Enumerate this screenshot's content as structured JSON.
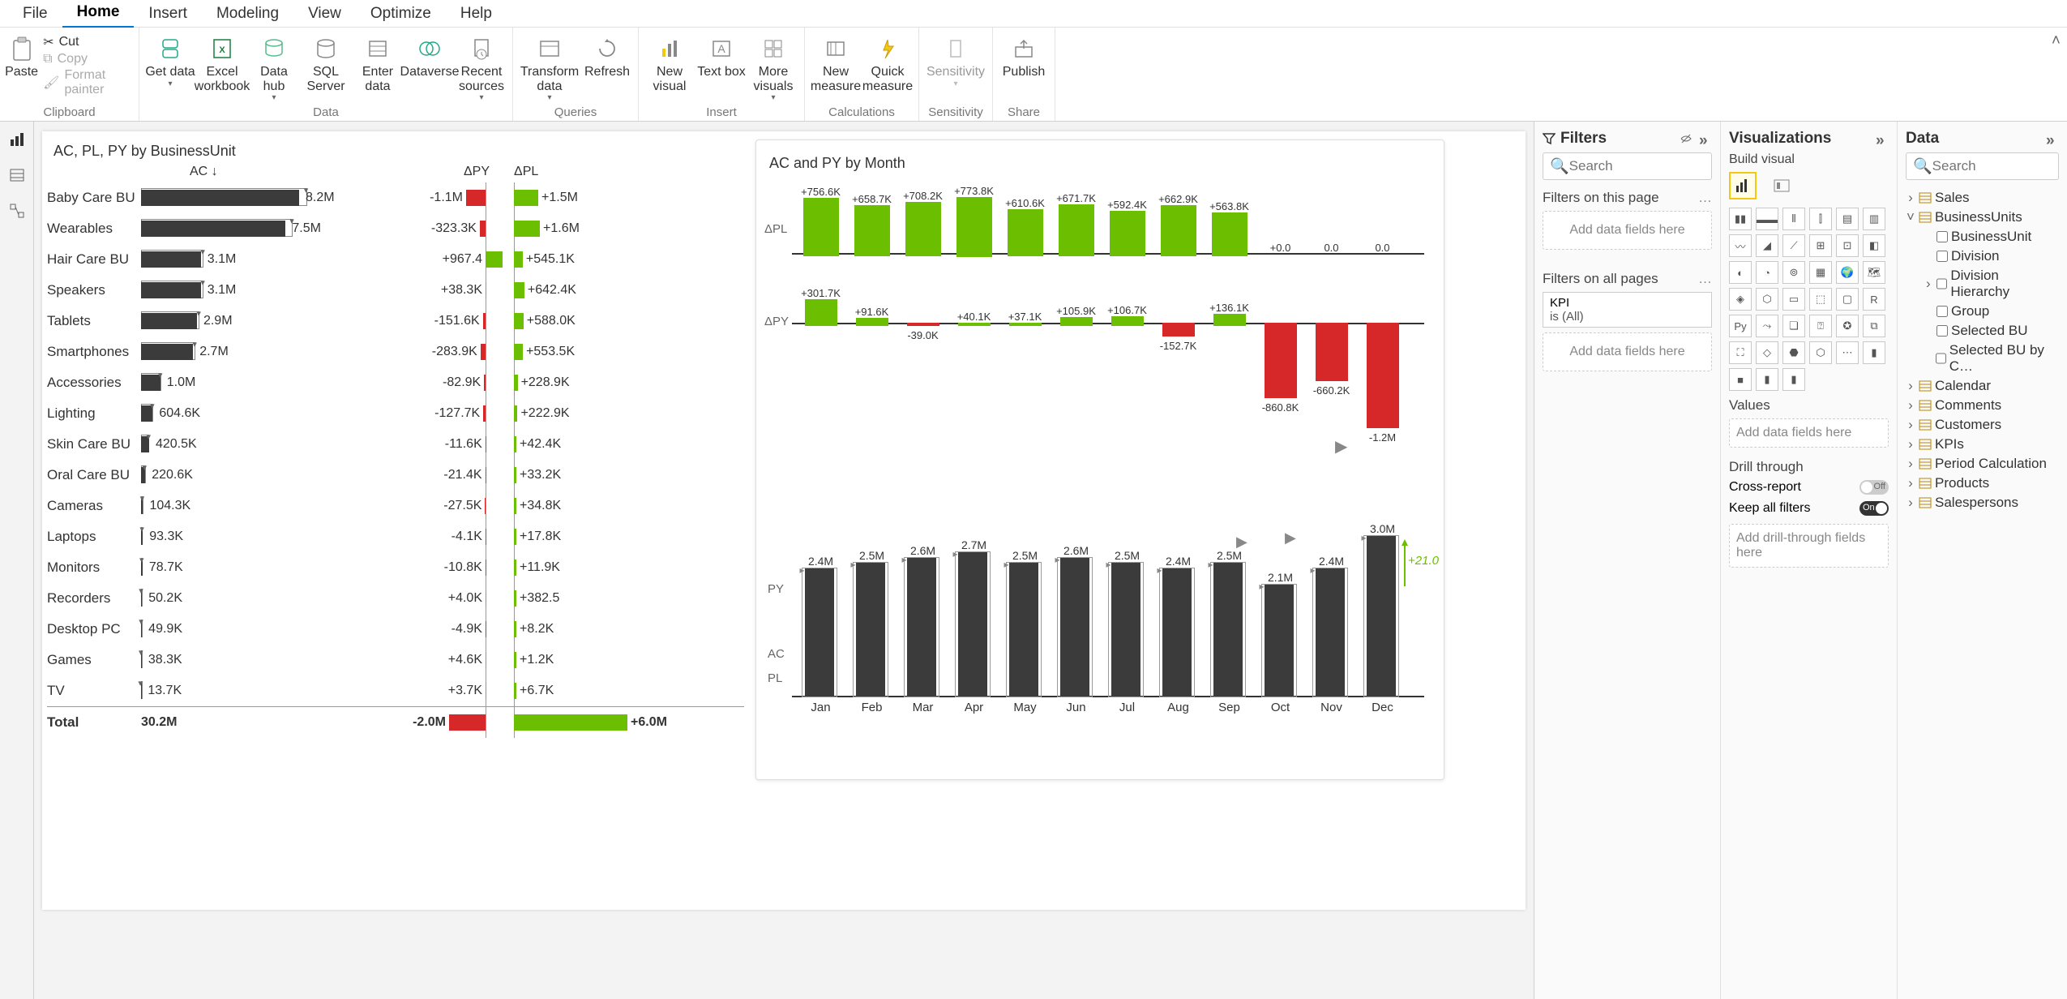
{
  "menubar": [
    "File",
    "Home",
    "Insert",
    "Modeling",
    "View",
    "Optimize",
    "Help"
  ],
  "menubar_active": 1,
  "ribbon": {
    "clipboard": {
      "paste": "Paste",
      "cut": "Cut",
      "copy": "Copy",
      "format_painter": "Format painter",
      "group": "Clipboard"
    },
    "data": {
      "get_data": "Get data",
      "excel": "Excel workbook",
      "data_hub": "Data hub",
      "sql": "SQL Server",
      "enter": "Enter data",
      "dataverse": "Dataverse",
      "recent": "Recent sources",
      "group": "Data"
    },
    "queries": {
      "transform": "Transform data",
      "refresh": "Refresh",
      "group": "Queries"
    },
    "insert": {
      "new_visual": "New visual",
      "text_box": "Text box",
      "more": "More visuals",
      "group": "Insert"
    },
    "calc": {
      "new_measure": "New measure",
      "quick": "Quick measure",
      "group": "Calculations"
    },
    "sens": {
      "sensitivity": "Sensitivity",
      "group": "Sensitivity"
    },
    "share": {
      "publish": "Publish",
      "group": "Share"
    }
  },
  "filters_pane": {
    "title": "Filters",
    "search_placeholder": "Search",
    "on_page": "Filters on this page",
    "drop_text": "Add data fields here",
    "on_all": "Filters on all pages",
    "kpi_label": "KPI",
    "kpi_value": "is (All)"
  },
  "viz_pane": {
    "title": "Visualizations",
    "build": "Build visual",
    "values": "Values",
    "values_drop": "Add data fields here",
    "drill": "Drill through",
    "cross": "Cross-report",
    "keep": "Keep all filters",
    "drill_drop": "Add drill-through fields here",
    "off_label": "Off",
    "on_label": "On"
  },
  "data_pane": {
    "title": "Data",
    "search_placeholder": "Search",
    "tree": [
      {
        "label": "Sales",
        "type": "table",
        "expanded": false
      },
      {
        "label": "BusinessUnits",
        "type": "table",
        "expanded": true,
        "children": [
          {
            "label": "BusinessUnit",
            "check": true
          },
          {
            "label": "Division",
            "check": true
          },
          {
            "label": "Division Hierarchy",
            "check": true,
            "hier": true
          },
          {
            "label": "Group",
            "check": true
          },
          {
            "label": "Selected BU",
            "check": true
          },
          {
            "label": "Selected BU by C…",
            "check": true
          }
        ]
      },
      {
        "label": "Calendar",
        "type": "table",
        "expanded": false
      },
      {
        "label": "Comments",
        "type": "table",
        "expanded": false
      },
      {
        "label": "Customers",
        "type": "table",
        "expanded": false
      },
      {
        "label": "KPIs",
        "type": "table",
        "expanded": false
      },
      {
        "label": "Period Calculation",
        "type": "table",
        "expanded": false
      },
      {
        "label": "Products",
        "type": "table",
        "expanded": false
      },
      {
        "label": "Salespersons",
        "type": "table",
        "expanded": false
      }
    ]
  },
  "chart_data": {
    "bu_chart": {
      "title": "AC, PL, PY by BusinessUnit",
      "col_ac": "AC ↓",
      "col_dpy": "ΔPY",
      "col_dpl": "ΔPL",
      "rows": [
        {
          "name": "Baby Care BU",
          "ac": 8.2,
          "ac_label": "8.2M",
          "dpy": -1100,
          "dpy_label": "-1.1M",
          "dpl": 1500,
          "dpl_label": "+1.5M"
        },
        {
          "name": "Wearables",
          "ac": 7.5,
          "ac_label": "7.5M",
          "dpy": -323.3,
          "dpy_label": "-323.3K",
          "dpl": 1600,
          "dpl_label": "+1.6M"
        },
        {
          "name": "Hair Care BU",
          "ac": 3.1,
          "ac_label": "3.1M",
          "dpy": 967.4,
          "dpy_label": "+967.4",
          "dpl": 545.1,
          "dpl_label": "+545.1K"
        },
        {
          "name": "Speakers",
          "ac": 3.1,
          "ac_label": "3.1M",
          "dpy": 38.3,
          "dpy_label": "+38.3K",
          "dpl": 642.4,
          "dpl_label": "+642.4K"
        },
        {
          "name": "Tablets",
          "ac": 2.9,
          "ac_label": "2.9M",
          "dpy": -151.6,
          "dpy_label": "-151.6K",
          "dpl": 588,
          "dpl_label": "+588.0K"
        },
        {
          "name": "Smartphones",
          "ac": 2.7,
          "ac_label": "2.7M",
          "dpy": -283.9,
          "dpy_label": "-283.9K",
          "dpl": 553.5,
          "dpl_label": "+553.5K"
        },
        {
          "name": "Accessories",
          "ac": 1.0,
          "ac_label": "1.0M",
          "dpy": -82.9,
          "dpy_label": "-82.9K",
          "dpl": 228.9,
          "dpl_label": "+228.9K"
        },
        {
          "name": "Lighting",
          "ac": 0.6046,
          "ac_label": "604.6K",
          "dpy": -127.7,
          "dpy_label": "-127.7K",
          "dpl": 222.9,
          "dpl_label": "+222.9K"
        },
        {
          "name": "Skin Care BU",
          "ac": 0.4205,
          "ac_label": "420.5K",
          "dpy": -11.6,
          "dpy_label": "-11.6K",
          "dpl": 42.4,
          "dpl_label": "+42.4K"
        },
        {
          "name": "Oral Care BU",
          "ac": 0.2206,
          "ac_label": "220.6K",
          "dpy": -21.4,
          "dpy_label": "-21.4K",
          "dpl": 33.2,
          "dpl_label": "+33.2K"
        },
        {
          "name": "Cameras",
          "ac": 0.1043,
          "ac_label": "104.3K",
          "dpy": -27.5,
          "dpy_label": "-27.5K",
          "dpl": 34.8,
          "dpl_label": "+34.8K"
        },
        {
          "name": "Laptops",
          "ac": 0.0933,
          "ac_label": "93.3K",
          "dpy": -4.1,
          "dpy_label": "-4.1K",
          "dpl": 17.8,
          "dpl_label": "+17.8K"
        },
        {
          "name": "Monitors",
          "ac": 0.0787,
          "ac_label": "78.7K",
          "dpy": -10.8,
          "dpy_label": "-10.8K",
          "dpl": 11.9,
          "dpl_label": "+11.9K"
        },
        {
          "name": "Recorders",
          "ac": 0.0502,
          "ac_label": "50.2K",
          "dpy": 4,
          "dpy_label": "+4.0K",
          "dpl": 0.3825,
          "dpl_label": "+382.5"
        },
        {
          "name": "Desktop PC",
          "ac": 0.0499,
          "ac_label": "49.9K",
          "dpy": -4.9,
          "dpy_label": "-4.9K",
          "dpl": 8.2,
          "dpl_label": "+8.2K"
        },
        {
          "name": "Games",
          "ac": 0.0383,
          "ac_label": "38.3K",
          "dpy": 4.6,
          "dpy_label": "+4.6K",
          "dpl": 1.2,
          "dpl_label": "+1.2K"
        },
        {
          "name": "TV",
          "ac": 0.0137,
          "ac_label": "13.7K",
          "dpy": 3.7,
          "dpy_label": "+3.7K",
          "dpl": 6.7,
          "dpl_label": "+6.7K"
        }
      ],
      "total": {
        "name": "Total",
        "ac_label": "30.2M",
        "dpy_label": "-2.0M",
        "dpl_label": "+6.0M"
      }
    },
    "month_chart": {
      "title": "AC and PY by Month",
      "dpl_series": [
        {
          "m": "Jan",
          "v": 756.6,
          "label": "+756.6K"
        },
        {
          "m": "Feb",
          "v": 658.7,
          "label": "+658.7K"
        },
        {
          "m": "Mar",
          "v": 708.2,
          "label": "+708.2K"
        },
        {
          "m": "Apr",
          "v": 773.8,
          "label": "+773.8K"
        },
        {
          "m": "May",
          "v": 610.6,
          "label": "+610.6K"
        },
        {
          "m": "Jun",
          "v": 671.7,
          "label": "+671.7K"
        },
        {
          "m": "Jul",
          "v": 592.4,
          "label": "+592.4K"
        },
        {
          "m": "Aug",
          "v": 662.9,
          "label": "+662.9K"
        },
        {
          "m": "Sep",
          "v": 563.8,
          "label": "+563.8K"
        },
        {
          "m": "Oct",
          "v": 0,
          "label": "+0.0"
        },
        {
          "m": "Nov",
          "v": 0,
          "label": "0.0"
        },
        {
          "m": "Dec",
          "v": 0,
          "label": "0.0"
        }
      ],
      "dpy_series": [
        {
          "m": "Jan",
          "v": 301.7,
          "label": "+301.7K"
        },
        {
          "m": "Feb",
          "v": 91.6,
          "label": "+91.6K"
        },
        {
          "m": "Mar",
          "v": -39,
          "label": "-39.0K"
        },
        {
          "m": "Apr",
          "v": 40.1,
          "label": "+40.1K"
        },
        {
          "m": "May",
          "v": 37.1,
          "label": "+37.1K"
        },
        {
          "m": "Jun",
          "v": 105.9,
          "label": "+105.9K"
        },
        {
          "m": "Jul",
          "v": 106.7,
          "label": "+106.7K"
        },
        {
          "m": "Aug",
          "v": -152.7,
          "label": "-152.7K"
        },
        {
          "m": "Sep",
          "v": 136.1,
          "label": "+136.1K"
        },
        {
          "m": "Oct",
          "v": -860.8,
          "label": "-860.8K"
        },
        {
          "m": "Nov",
          "v": -660.2,
          "label": "-660.2K"
        },
        {
          "m": "Dec",
          "v": -1200,
          "label": "-1.2M"
        }
      ],
      "ac_series": [
        {
          "m": "Jan",
          "v": 2.4,
          "label": "2.4M"
        },
        {
          "m": "Feb",
          "v": 2.5,
          "label": "2.5M"
        },
        {
          "m": "Mar",
          "v": 2.6,
          "label": "2.6M"
        },
        {
          "m": "Apr",
          "v": 2.7,
          "label": "2.7M"
        },
        {
          "m": "May",
          "v": 2.5,
          "label": "2.5M"
        },
        {
          "m": "Jun",
          "v": 2.6,
          "label": "2.6M"
        },
        {
          "m": "Jul",
          "v": 2.5,
          "label": "2.5M"
        },
        {
          "m": "Aug",
          "v": 2.4,
          "label": "2.4M"
        },
        {
          "m": "Sep",
          "v": 2.5,
          "label": "2.5M"
        },
        {
          "m": "Oct",
          "v": 2.1,
          "label": "2.1M"
        },
        {
          "m": "Nov",
          "v": 2.4,
          "label": "2.4M"
        },
        {
          "m": "Dec",
          "v": 3.0,
          "label": "3.0M"
        }
      ],
      "delta_right": "+21.0",
      "seg_dpl": "ΔPL",
      "seg_dpy": "ΔPY",
      "seg_py": "PY",
      "seg_ac": "AC",
      "seg_pl": "PL"
    }
  }
}
